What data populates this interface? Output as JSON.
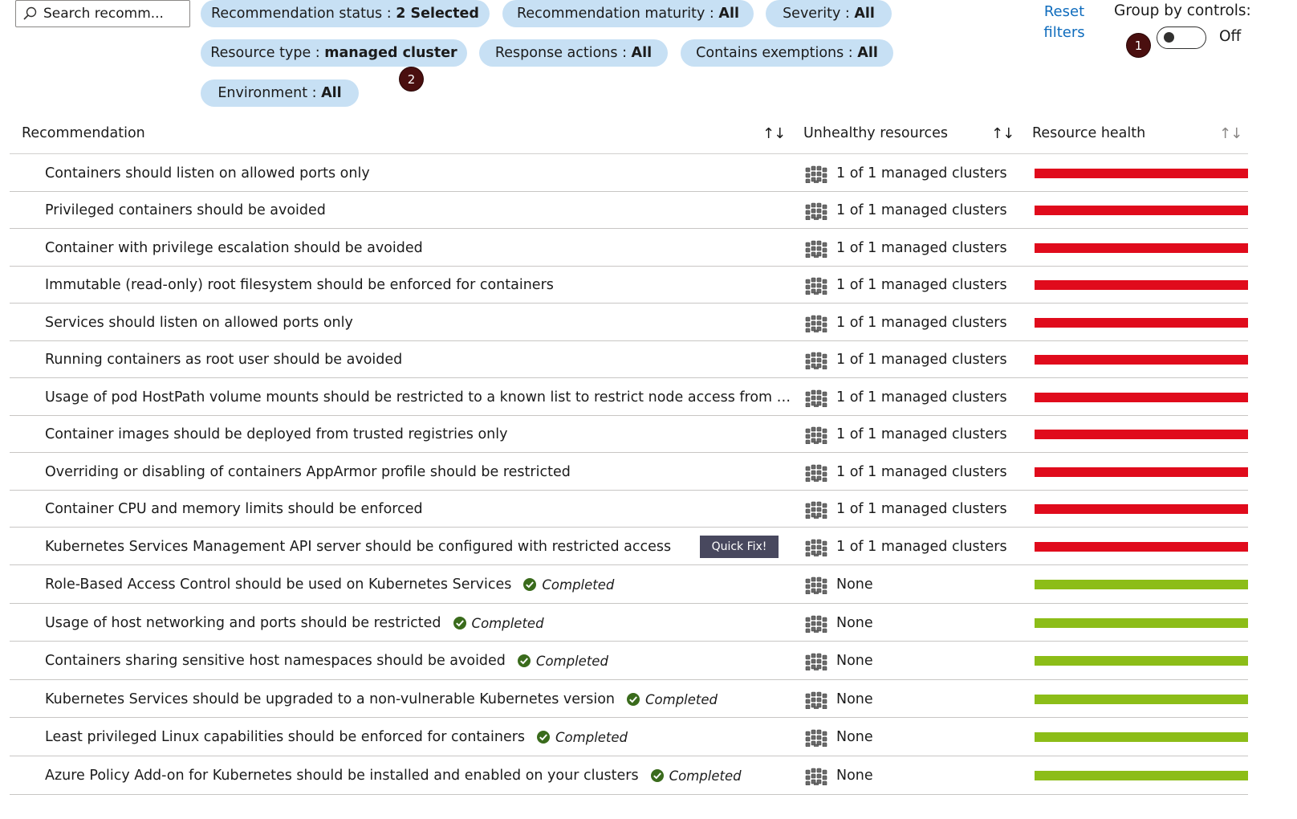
{
  "search": {
    "placeholder": "Search recomm..."
  },
  "filters": [
    {
      "label": "Recommendation status : ",
      "value": "2 Selected"
    },
    {
      "label": "Recommendation maturity : ",
      "value": "All"
    },
    {
      "label": "Severity : ",
      "value": "All"
    },
    {
      "label": "Resource type : ",
      "value": "managed cluster"
    },
    {
      "label": "Response actions : ",
      "value": "All"
    },
    {
      "label": "Contains exemptions : ",
      "value": "All"
    },
    {
      "label": "Environment : ",
      "value": "All"
    }
  ],
  "reset_filters": "Reset filters",
  "group_by": {
    "label": "Group by controls:",
    "state": "Off"
  },
  "badges": [
    "1",
    "2"
  ],
  "columns": {
    "recommendation": "Recommendation",
    "unhealthy": "Unhealthy resources",
    "health": "Resource health",
    "sort_icon": "↑↓"
  },
  "colors": {
    "unhealthy": "#e00b1c",
    "healthy": "#8cbd18",
    "pill": "#c7e0f4",
    "completed_icon": "#3a6b1c"
  },
  "quick_fix_label": "Quick Fix!",
  "completed_label": "Completed",
  "rows": [
    {
      "name": "Containers should listen on allowed ports only",
      "resources": "1 of 1 managed clusters",
      "status": "unhealthy"
    },
    {
      "name": "Privileged containers should be avoided",
      "resources": "1 of 1 managed clusters",
      "status": "unhealthy"
    },
    {
      "name": "Container with privilege escalation should be avoided",
      "resources": "1 of 1 managed clusters",
      "status": "unhealthy"
    },
    {
      "name": "Immutable (read-only) root filesystem should be enforced for containers",
      "resources": "1 of 1 managed clusters",
      "status": "unhealthy"
    },
    {
      "name": "Services should listen on allowed ports only",
      "resources": "1 of 1 managed clusters",
      "status": "unhealthy"
    },
    {
      "name": "Running containers as root user should be avoided",
      "resources": "1 of 1 managed clusters",
      "status": "unhealthy"
    },
    {
      "name": "Usage of pod HostPath volume mounts should be restricted to a known list to restrict node access from co...",
      "resources": "1 of 1 managed clusters",
      "status": "unhealthy"
    },
    {
      "name": "Container images should be deployed from trusted registries only",
      "resources": "1 of 1 managed clusters",
      "status": "unhealthy"
    },
    {
      "name": "Overriding or disabling of containers AppArmor profile should be restricted",
      "resources": "1 of 1 managed clusters",
      "status": "unhealthy"
    },
    {
      "name": "Container CPU and memory limits should be enforced",
      "resources": "1 of 1 managed clusters",
      "status": "unhealthy"
    },
    {
      "name": "Kubernetes Services Management API server should be configured with restricted access",
      "resources": "1 of 1 managed clusters",
      "status": "unhealthy",
      "quick_fix": true
    },
    {
      "name": "Role-Based Access Control should be used on Kubernetes Services",
      "resources": "None",
      "status": "healthy",
      "completed": true
    },
    {
      "name": "Usage of host networking and ports should be restricted",
      "resources": "None",
      "status": "healthy",
      "completed": true
    },
    {
      "name": "Containers sharing sensitive host namespaces should be avoided",
      "resources": "None",
      "status": "healthy",
      "completed": true
    },
    {
      "name": "Kubernetes Services should be upgraded to a non-vulnerable Kubernetes version",
      "resources": "None",
      "status": "healthy",
      "completed": true
    },
    {
      "name": "Least privileged Linux capabilities should be enforced for containers",
      "resources": "None",
      "status": "healthy",
      "completed": true
    },
    {
      "name": "Azure Policy Add-on for Kubernetes should be installed and enabled on your clusters",
      "resources": "None",
      "status": "healthy",
      "completed": true
    }
  ]
}
